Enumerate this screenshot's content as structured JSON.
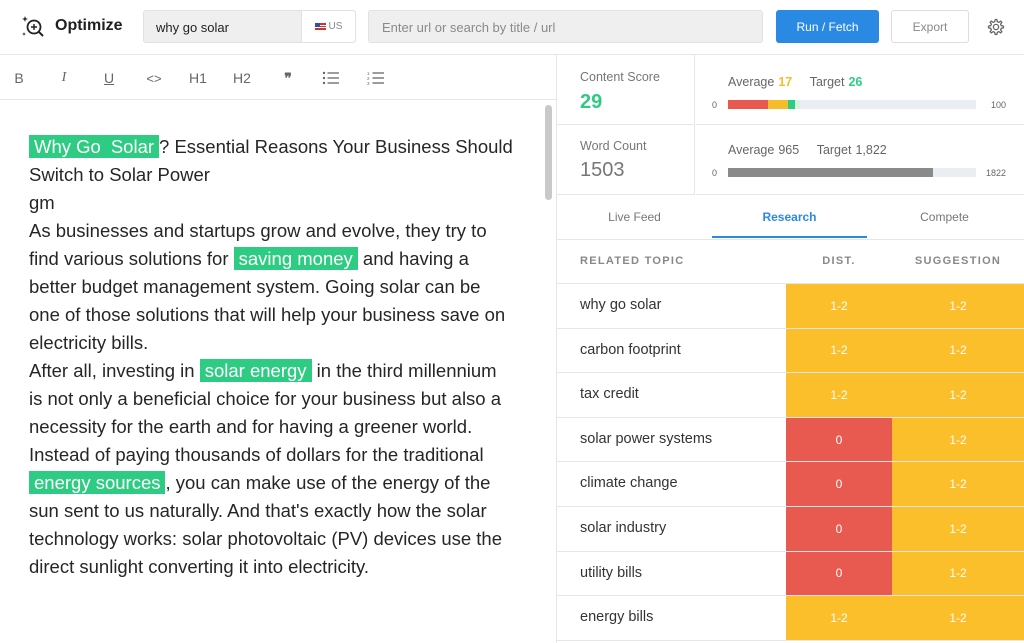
{
  "app": {
    "title": "Optimize"
  },
  "search": {
    "keyword": "why go solar",
    "country": "US",
    "url_placeholder": "Enter url or search by title / url"
  },
  "buttons": {
    "fetch": "Run / Fetch",
    "export": "Export"
  },
  "toolbar": {
    "bold": "B",
    "italic": "I",
    "underline": "U",
    "code": "<>",
    "h1": "H1",
    "h2": "H2",
    "quote": "❞"
  },
  "editor": {
    "title_pre_hl1": "Why Go",
    "title_hl2": "Solar",
    "title_rest": "? Essential Reasons Your Business Should Switch to Solar Power",
    "line2": "gm",
    "p1_a": "As businesses and startups grow and evolve, they try to find various solutions for ",
    "p1_hl": "saving money",
    "p1_b": " and having a better budget management system. Going solar can be one of those solutions that will help your business save on electricity bills.",
    "p2_a": "After all, investing in ",
    "p2_hl": "solar energy",
    "p2_b": " in the third millennium is not only a beneficial choice for your business but also a necessity for the earth and for having a greener world.",
    "p3_a": "Instead of paying thousands of dollars for the traditional ",
    "p3_hl": "energy sources",
    "p3_b": ", you can make use of the energy of the sun sent to us naturally. And that's exactly how the solar technology works: solar photovoltaic (PV) devices use the direct sunlight converting it into electricity."
  },
  "content_score": {
    "label": "Content Score",
    "value": "29",
    "average_label": "Average",
    "average": "17",
    "target_label": "Target",
    "target": "26",
    "min": "0",
    "max": "100",
    "segments": [
      {
        "color": "#e85a4f",
        "fraction": 0.16
      },
      {
        "color": "#f5bd2a",
        "fraction": 0.08
      },
      {
        "color": "#2ecc82",
        "fraction": 0.03
      },
      {
        "color": "#d5f2e3",
        "fraction": 0.02
      }
    ]
  },
  "word_count": {
    "label": "Word Count",
    "value": "1503",
    "average_label": "Average",
    "average": "965",
    "target_label": "Target",
    "target": "1,822",
    "min": "0",
    "max": "1822",
    "fill_color": "#8a8a8a",
    "fill_fraction": 0.825
  },
  "tabs": [
    "Live Feed",
    "Research",
    "Compete"
  ],
  "table": {
    "headers": {
      "topic": "RELATED TOPIC",
      "dist": "DIST.",
      "suggestion": "SUGGESTION"
    },
    "rows": [
      {
        "topic": "why go solar",
        "dist": "1-2",
        "dist_color": "#fbbf2c",
        "suggestion": "1-2",
        "suggestion_color": "#fbbf2c"
      },
      {
        "topic": "carbon footprint",
        "dist": "1-2",
        "dist_color": "#fbbf2c",
        "suggestion": "1-2",
        "suggestion_color": "#fbbf2c"
      },
      {
        "topic": "tax credit",
        "dist": "1-2",
        "dist_color": "#fbbf2c",
        "suggestion": "1-2",
        "suggestion_color": "#fbbf2c"
      },
      {
        "topic": "solar power systems",
        "dist": "0",
        "dist_color": "#e85a4f",
        "suggestion": "1-2",
        "suggestion_color": "#fbbf2c"
      },
      {
        "topic": "climate change",
        "dist": "0",
        "dist_color": "#e85a4f",
        "suggestion": "1-2",
        "suggestion_color": "#fbbf2c"
      },
      {
        "topic": "solar industry",
        "dist": "0",
        "dist_color": "#e85a4f",
        "suggestion": "1-2",
        "suggestion_color": "#fbbf2c"
      },
      {
        "topic": "utility bills",
        "dist": "0",
        "dist_color": "#e85a4f",
        "suggestion": "1-2",
        "suggestion_color": "#fbbf2c"
      },
      {
        "topic": "energy bills",
        "dist": "1-2",
        "dist_color": "#fbbf2c",
        "suggestion": "1-2",
        "suggestion_color": "#fbbf2c"
      }
    ]
  },
  "icons": {
    "logo": "magnify-sparkle-icon",
    "settings": "gear-icon",
    "bullet_list": "bulleted-list-icon",
    "numbered_list": "numbered-list-icon"
  },
  "colors": {
    "accent": "#2a8ae3",
    "highlight": "#2ecc82",
    "warning": "#fbbf2c",
    "danger": "#e85a4f"
  }
}
